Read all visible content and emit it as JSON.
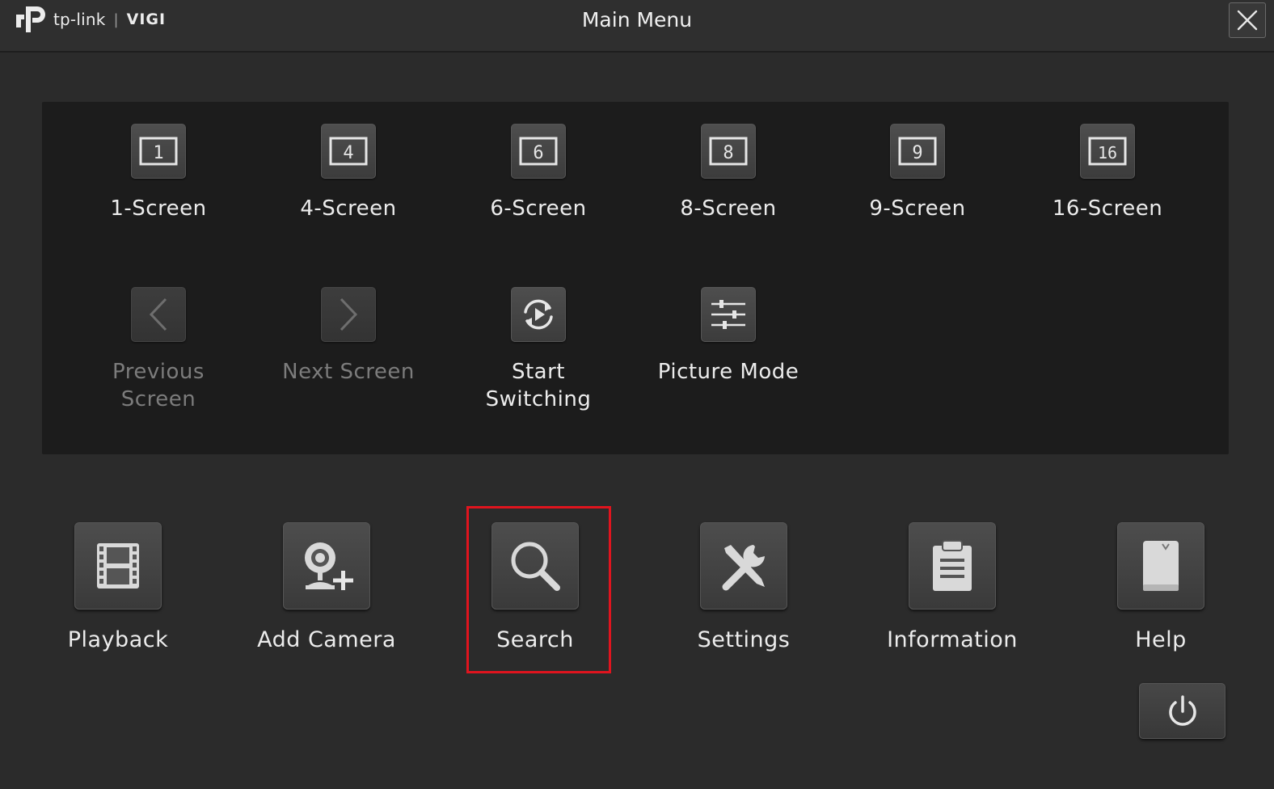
{
  "header": {
    "logo_brand": "tp-link",
    "logo_separator": "|",
    "logo_product": "VIGI",
    "title": "Main Menu",
    "close_icon": "close-icon"
  },
  "view_panel": {
    "tiles": [
      {
        "label": "1-Screen",
        "badge": "1",
        "icon": "layout-1-icon",
        "enabled": true
      },
      {
        "label": "4-Screen",
        "badge": "4",
        "icon": "layout-4-icon",
        "enabled": true
      },
      {
        "label": "6-Screen",
        "badge": "6",
        "icon": "layout-6-icon",
        "enabled": true
      },
      {
        "label": "8-Screen",
        "badge": "8",
        "icon": "layout-8-icon",
        "enabled": true
      },
      {
        "label": "9-Screen",
        "badge": "9",
        "icon": "layout-9-icon",
        "enabled": true
      },
      {
        "label": "16-Screen",
        "badge": "16",
        "icon": "layout-16-icon",
        "enabled": true
      },
      {
        "label_line1": "Previous",
        "label_line2": "Screen",
        "icon": "chevron-left-icon",
        "enabled": false
      },
      {
        "label": "Next Screen",
        "icon": "chevron-right-icon",
        "enabled": false
      },
      {
        "label_line1": "Start",
        "label_line2": "Switching",
        "icon": "auto-switch-icon",
        "enabled": true
      },
      {
        "label": "Picture Mode",
        "icon": "sliders-icon",
        "enabled": true
      }
    ]
  },
  "main_actions": [
    {
      "label": "Playback",
      "icon": "film-icon"
    },
    {
      "label": "Add Camera",
      "icon": "add-camera-icon"
    },
    {
      "label": "Search",
      "icon": "search-icon",
      "highlighted": true
    },
    {
      "label": "Settings",
      "icon": "tools-icon"
    },
    {
      "label": "Information",
      "icon": "clipboard-icon"
    },
    {
      "label": "Help",
      "icon": "book-icon"
    }
  ],
  "power": {
    "icon": "power-icon"
  },
  "colors": {
    "background": "#2b2b2b",
    "panel": "#1c1c1c",
    "highlight": "#e0141e",
    "text": "#ececec",
    "text_disabled": "#7c7c7c"
  }
}
